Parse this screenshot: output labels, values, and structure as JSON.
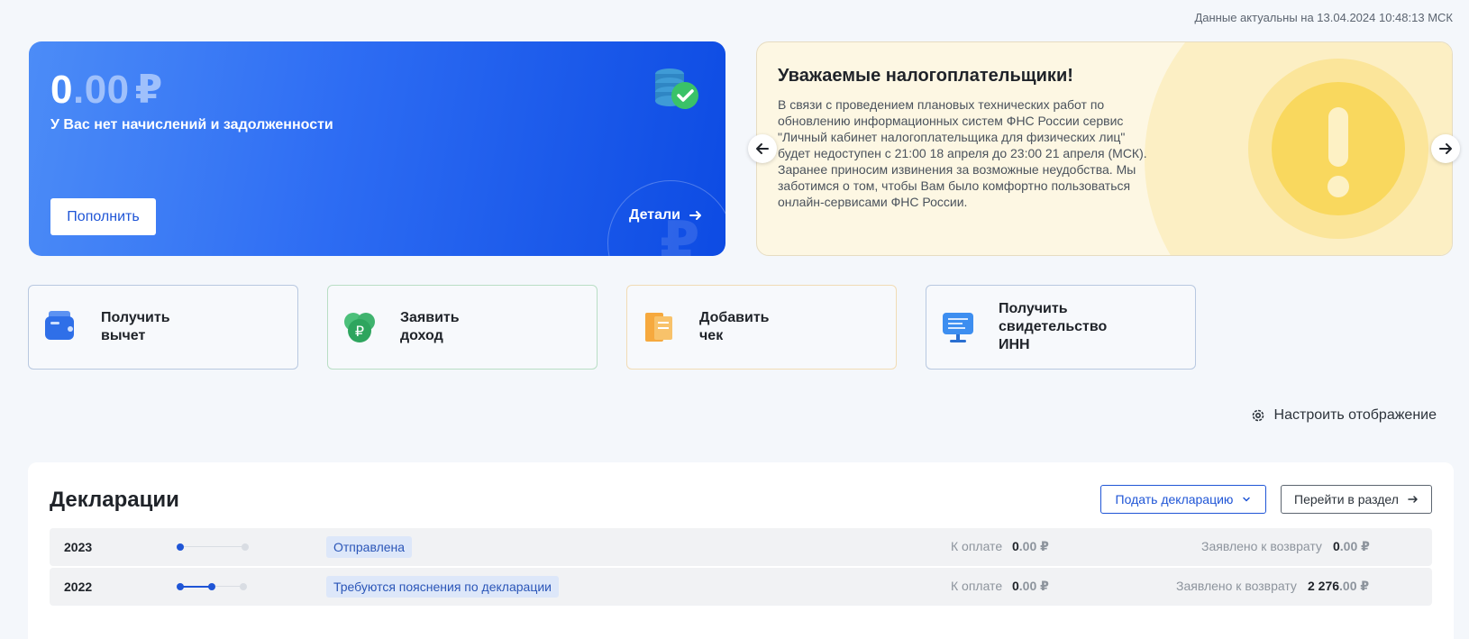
{
  "header": {
    "updated_text": "Данные актуальны на 13.04.2024 10:48:13 МСК"
  },
  "balance": {
    "amount_int": "0",
    "amount_frac": ".00",
    "currency": "₽",
    "message": "У Вас нет начислений и задолженности",
    "topup_label": "Пополнить",
    "details_label": "Детали"
  },
  "notice": {
    "title": "Уважаемые налогоплательщики!",
    "text": "В связи с проведением плановых технических работ по обновлению информационных систем ФНС России сервис \"Личный кабинет налогоплательщика для физических лиц\" будет недоступен с 21:00 18 апреля до 23:00 21 апреля (МСК). Заранее приносим извинения за возможные неудобства. Мы заботимся о том, чтобы Вам было комфортно пользоваться онлайн-сервисами ФНС России."
  },
  "tiles": [
    {
      "line1": "Получить",
      "line2": "вычет",
      "line3": ""
    },
    {
      "line1": "Заявить",
      "line2": "доход",
      "line3": ""
    },
    {
      "line1": "Добавить",
      "line2": "чек",
      "line3": ""
    },
    {
      "line1": "Получить",
      "line2": "свидетельство",
      "line3": "ИНН"
    }
  ],
  "settings_label": "Настроить отображение",
  "declarations": {
    "title": "Декларации",
    "submit_label": "Подать декларацию",
    "go_label": "Перейти в раздел",
    "rows": [
      {
        "year": "2023",
        "status": "Отправлена",
        "progress_step": 1,
        "progress_total": 3,
        "pay_label": "К оплате",
        "pay_int": "0",
        "pay_frac": ".00 ₽",
        "return_label": "Заявлено к возврату",
        "return_int": "0",
        "return_frac": ".00 ₽"
      },
      {
        "year": "2022",
        "status": "Требуются пояснения по декларации",
        "progress_step": 2,
        "progress_total": 3,
        "pay_label": "К оплате",
        "pay_int": "0",
        "pay_frac": ".00 ₽",
        "return_label": "Заявлено к возврату",
        "return_int": "2 276",
        "return_frac": ".00 ₽"
      }
    ]
  },
  "colors": {
    "accent": "#1f55d6",
    "card_blue": "#2d6cf3",
    "notice_bg": "#fdf7e3"
  }
}
